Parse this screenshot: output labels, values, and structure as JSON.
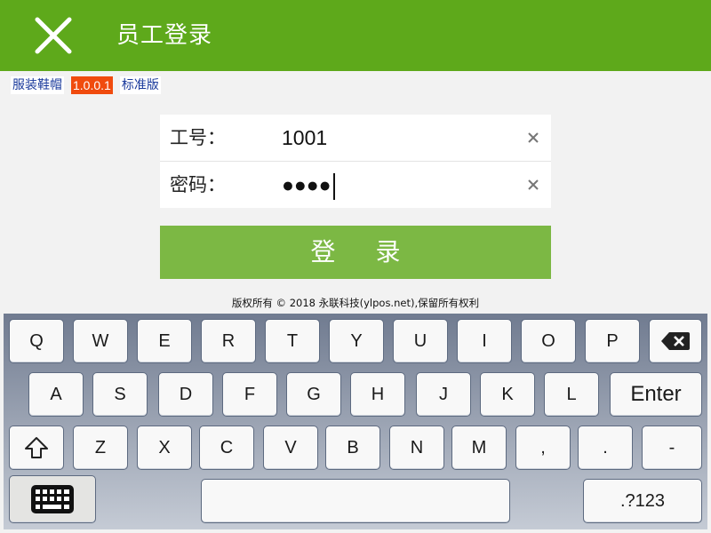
{
  "header": {
    "title": "员工登录",
    "close_icon": "close-icon"
  },
  "version_bar": {
    "product": "服装鞋帽",
    "version": "1.0.0.1",
    "edition": "标准版"
  },
  "login_form": {
    "employee_id": {
      "label": "工号：",
      "value": "1001",
      "clear_icon": "clear-icon"
    },
    "password": {
      "label": "密码：",
      "masked_value": "●●●●",
      "clear_icon": "clear-icon"
    },
    "login_button": "登 录"
  },
  "copyright": "版权所有 © 2018 永联科技(ylpos.net),保留所有权利",
  "colors": {
    "header_bg": "#5ea91b",
    "login_button_bg": "#7cb844",
    "version_badge_bg": "#f04b0e",
    "link_text": "#1a3a9c"
  },
  "keyboard": {
    "row1": [
      "Q",
      "W",
      "E",
      "R",
      "T",
      "Y",
      "U",
      "I",
      "O",
      "P"
    ],
    "row2": [
      "A",
      "S",
      "D",
      "F",
      "G",
      "H",
      "J",
      "K",
      "L"
    ],
    "row3": [
      "Z",
      "X",
      "C",
      "V",
      "B",
      "N",
      "M",
      ",",
      "."
    ],
    "enter": "Enter",
    "dash": "-",
    "symbols": ".?123",
    "icons": {
      "backspace": "backspace-icon",
      "shift": "shift-icon",
      "keyboard": "keyboard-icon"
    }
  }
}
